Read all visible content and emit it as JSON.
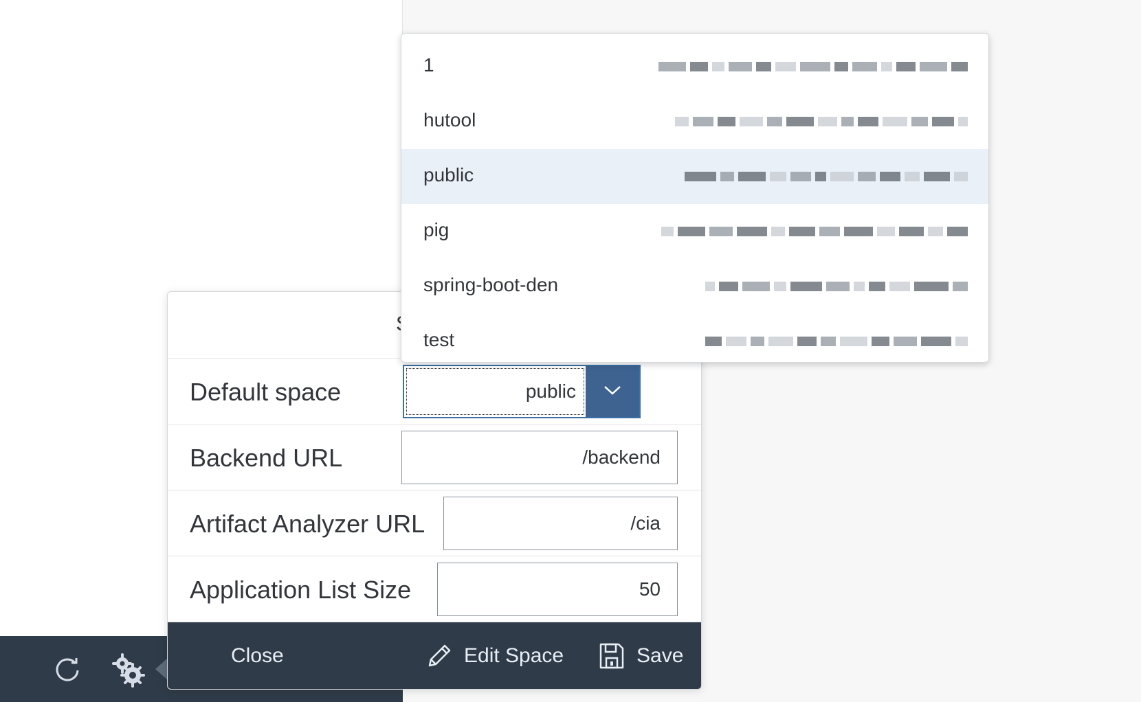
{
  "toolbar": {
    "refresh_icon": "refresh-icon",
    "settings_icon": "settings-gear-icon"
  },
  "dialog": {
    "title": "S",
    "rows": [
      {
        "label": "Default space",
        "value": "public"
      },
      {
        "label": "Backend URL",
        "value": "/backend"
      },
      {
        "label": "Artifact Analyzer URL",
        "value": "/cia"
      },
      {
        "label": "Application List Size",
        "value": "50"
      }
    ],
    "footer": {
      "close_label": "Close",
      "edit_space_label": "Edit Space",
      "save_label": "Save"
    }
  },
  "dropdown": {
    "items": [
      {
        "label": "1",
        "selected": false
      },
      {
        "label": "hutool",
        "selected": false
      },
      {
        "label": "public",
        "selected": true
      },
      {
        "label": "pig",
        "selected": false
      },
      {
        "label": "spring-boot-den",
        "selected": false
      },
      {
        "label": "test",
        "selected": false
      }
    ]
  },
  "colors": {
    "toolbar_bg": "#2f3b48",
    "accent": "#3e6391",
    "selected_row": "#eaf0f7"
  }
}
